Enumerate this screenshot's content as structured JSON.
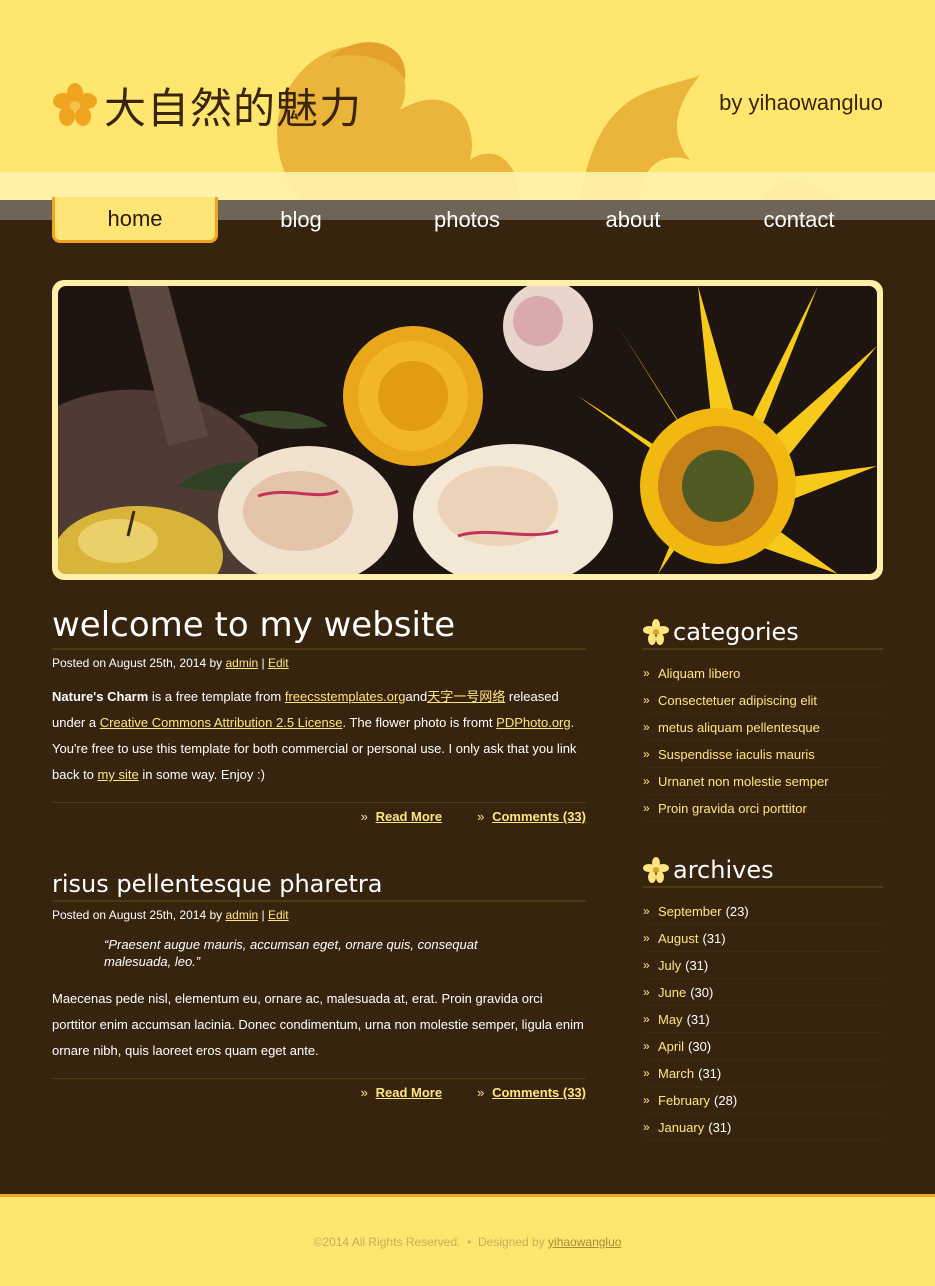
{
  "site": {
    "title": "大自然的魅力",
    "byline": "by yihaowangluo"
  },
  "menu": [
    {
      "label": "home",
      "active": true
    },
    {
      "label": "blog",
      "active": false
    },
    {
      "label": "photos",
      "active": false
    },
    {
      "label": "about",
      "active": false
    },
    {
      "label": "contact",
      "active": false
    }
  ],
  "posts": [
    {
      "title": "welcome to my website",
      "meta_prefix": "Posted on August 25th, 2014 by ",
      "meta_author": "admin",
      "meta_sep": " | ",
      "meta_edit": "Edit",
      "entry": {
        "strong": "Nature's Charm",
        "t1": " is a free template from ",
        "link1": "freecsstemplates.org",
        "t2": "and",
        "link2": "天字一号网络",
        "t3": " released under a ",
        "link3": "Creative Commons Attribution 2.5 License",
        "t4": ". The flower photo is fromt ",
        "link4": "PDPhoto.org",
        "t5": ". You're free to use this template for both commercial or personal use. I only ask that you link back to ",
        "link5": "my site",
        "t6": " in some way. Enjoy :)"
      },
      "read_more": "Read More",
      "comments": "Comments (33)"
    },
    {
      "title": "risus pellentesque pharetra",
      "meta_prefix": "Posted on August 25th, 2014 by ",
      "meta_author": "admin",
      "meta_sep": " | ",
      "meta_edit": "Edit",
      "quote": "“Praesent augue mauris, accumsan eget, ornare quis, consequat malesuada, leo.”",
      "body": "Maecenas pede nisl, elementum eu, ornare ac, malesuada at, erat. Proin gravida orci porttitor enim accumsan lacinia. Donec condimentum, urna non molestie semper, ligula enim ornare nibh, quis laoreet eros quam eget ante.",
      "read_more": "Read More",
      "comments": "Comments (33)"
    }
  ],
  "sidebar": {
    "categories_title": "categories",
    "categories": [
      "Aliquam libero",
      "Consectetuer adipiscing elit",
      "metus aliquam pellentesque",
      "Suspendisse iaculis mauris",
      "Urnanet non molestie semper",
      "Proin gravida orci porttitor"
    ],
    "archives_title": "archives",
    "archives": [
      {
        "month": "September",
        "count": "(23)"
      },
      {
        "month": "August",
        "count": "(31)"
      },
      {
        "month": "July",
        "count": "(31)"
      },
      {
        "month": "June",
        "count": "(30)"
      },
      {
        "month": "May",
        "count": "(31)"
      },
      {
        "month": "April",
        "count": "(30)"
      },
      {
        "month": "March",
        "count": "(31)"
      },
      {
        "month": "February",
        "count": "(28)"
      },
      {
        "month": "January",
        "count": "(31)"
      }
    ]
  },
  "footer": {
    "text": "©2014 All Rights Reserved.  •  Designed by ",
    "link": "yihaowangluo"
  },
  "colors": {
    "header_bg": "#ffe76f",
    "body_bg": "#37240f",
    "accent": "#f0a520",
    "link": "#ffe580"
  }
}
